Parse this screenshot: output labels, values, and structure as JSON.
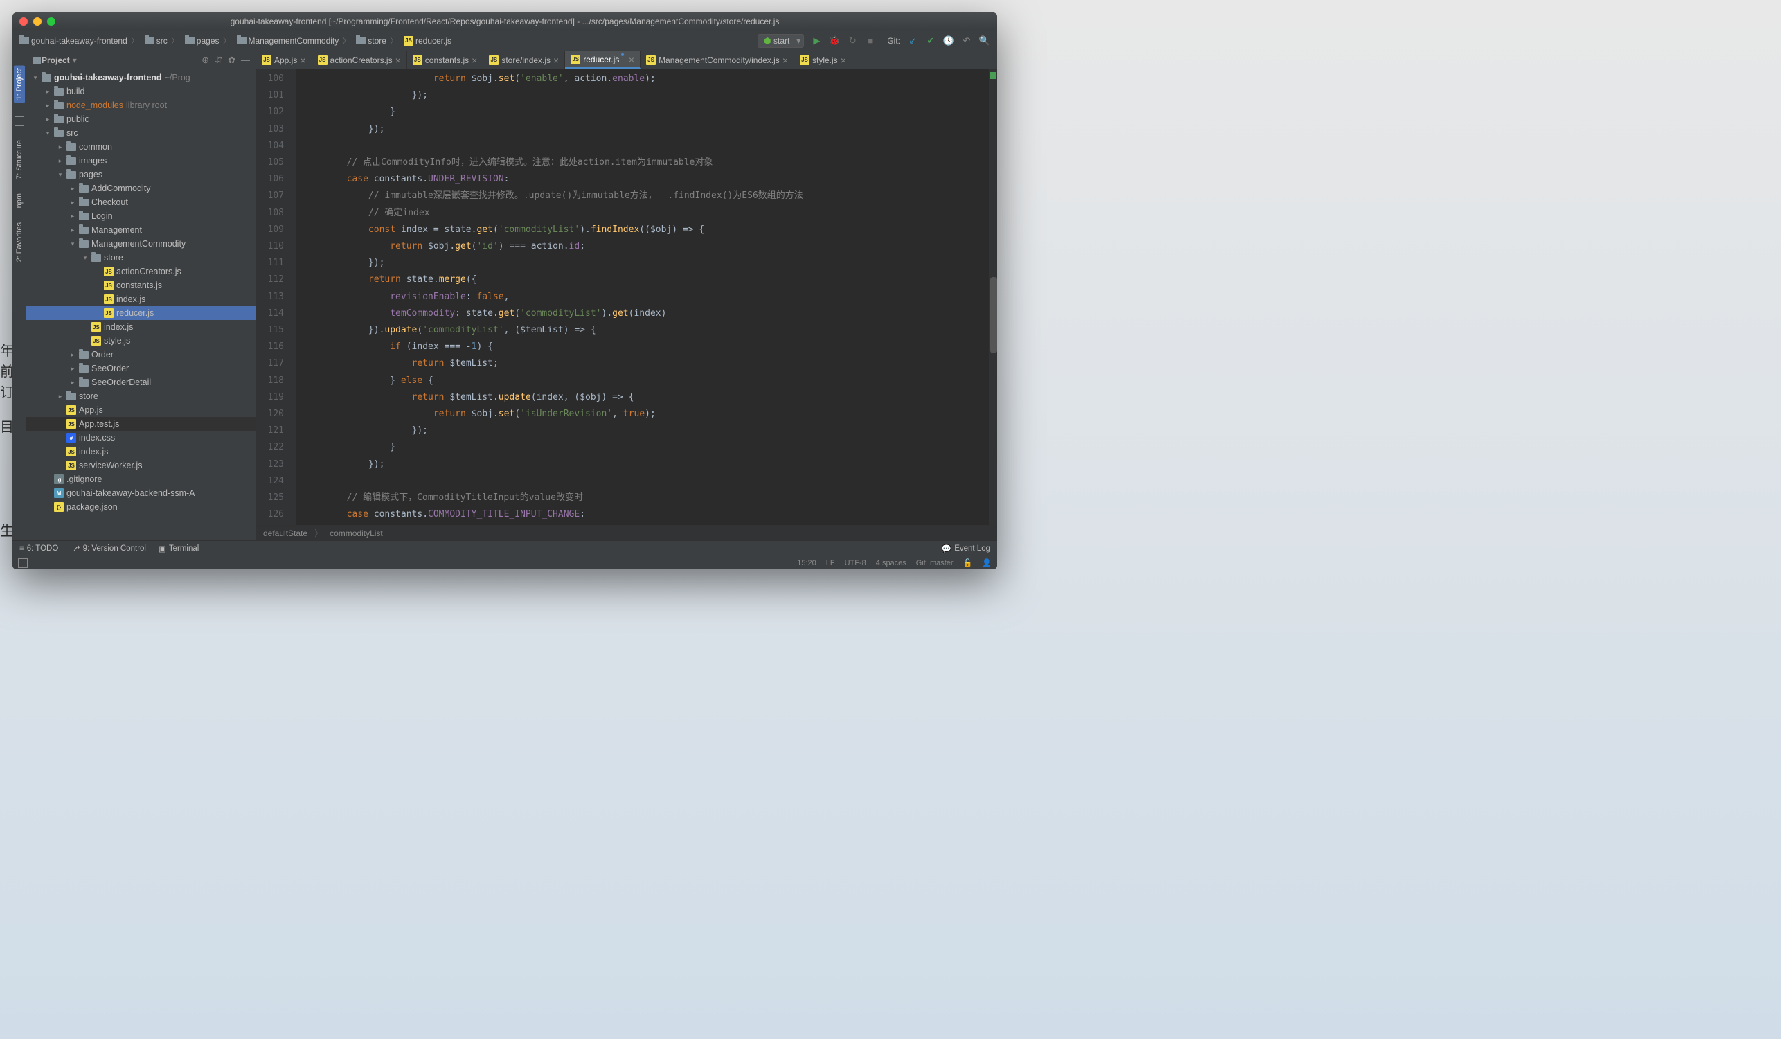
{
  "window": {
    "title": "gouhai-takeaway-frontend [~/Programming/Frontend/React/Repos/gouhai-takeaway-frontend] - .../src/pages/ManagementCommodity/store/reducer.js"
  },
  "nav": {
    "crumbs": [
      "gouhai-takeaway-frontend",
      "src",
      "pages",
      "ManagementCommodity",
      "store",
      "reducer.js"
    ],
    "run_config": "start",
    "git_label": "Git:"
  },
  "project_panel": {
    "title": "Project"
  },
  "tree": {
    "root_name": "gouhai-takeaway-frontend",
    "root_path": "~/Prog",
    "items": [
      {
        "depth": 1,
        "arrow": "▸",
        "icon": "folder",
        "label": "build"
      },
      {
        "depth": 1,
        "arrow": "▸",
        "icon": "folder",
        "label": "node_modules",
        "suffix": "library root",
        "class": "highlighted"
      },
      {
        "depth": 1,
        "arrow": "▸",
        "icon": "folder",
        "label": "public"
      },
      {
        "depth": 1,
        "arrow": "▾",
        "icon": "folder",
        "label": "src"
      },
      {
        "depth": 2,
        "arrow": "▸",
        "icon": "folder",
        "label": "common"
      },
      {
        "depth": 2,
        "arrow": "▸",
        "icon": "folder",
        "label": "images"
      },
      {
        "depth": 2,
        "arrow": "▾",
        "icon": "folder",
        "label": "pages"
      },
      {
        "depth": 3,
        "arrow": "▸",
        "icon": "folder",
        "label": "AddCommodity"
      },
      {
        "depth": 3,
        "arrow": "▸",
        "icon": "folder",
        "label": "Checkout"
      },
      {
        "depth": 3,
        "arrow": "▸",
        "icon": "folder",
        "label": "Login"
      },
      {
        "depth": 3,
        "arrow": "▸",
        "icon": "folder",
        "label": "Management"
      },
      {
        "depth": 3,
        "arrow": "▾",
        "icon": "folder",
        "label": "ManagementCommodity"
      },
      {
        "depth": 4,
        "arrow": "▾",
        "icon": "folder",
        "label": "store"
      },
      {
        "depth": 5,
        "arrow": "",
        "icon": "js",
        "label": "actionCreators.js"
      },
      {
        "depth": 5,
        "arrow": "",
        "icon": "js",
        "label": "constants.js"
      },
      {
        "depth": 5,
        "arrow": "",
        "icon": "js",
        "label": "index.js"
      },
      {
        "depth": 5,
        "arrow": "",
        "icon": "js",
        "label": "reducer.js",
        "sel": true
      },
      {
        "depth": 4,
        "arrow": "",
        "icon": "js",
        "label": "index.js"
      },
      {
        "depth": 4,
        "arrow": "",
        "icon": "js",
        "label": "style.js"
      },
      {
        "depth": 3,
        "arrow": "▸",
        "icon": "folder",
        "label": "Order"
      },
      {
        "depth": 3,
        "arrow": "▸",
        "icon": "folder",
        "label": "SeeOrder"
      },
      {
        "depth": 3,
        "arrow": "▸",
        "icon": "folder",
        "label": "SeeOrderDetail"
      },
      {
        "depth": 2,
        "arrow": "▸",
        "icon": "folder",
        "label": "store"
      },
      {
        "depth": 2,
        "arrow": "",
        "icon": "js",
        "label": "App.js"
      },
      {
        "depth": 2,
        "arrow": "",
        "icon": "js",
        "label": "App.test.js",
        "hl": true
      },
      {
        "depth": 2,
        "arrow": "",
        "icon": "css",
        "label": "index.css"
      },
      {
        "depth": 2,
        "arrow": "",
        "icon": "js",
        "label": "index.js"
      },
      {
        "depth": 2,
        "arrow": "",
        "icon": "js",
        "label": "serviceWorker.js"
      },
      {
        "depth": 1,
        "arrow": "",
        "icon": "gi",
        "label": ".gitignore"
      },
      {
        "depth": 1,
        "arrow": "",
        "icon": "md",
        "label": "gouhai-takeaway-backend-ssm-A"
      },
      {
        "depth": 1,
        "arrow": "",
        "icon": "json",
        "label": "package.json"
      }
    ]
  },
  "tabs": [
    {
      "label": "App.js"
    },
    {
      "label": "actionCreators.js"
    },
    {
      "label": "constants.js"
    },
    {
      "label": "store/index.js"
    },
    {
      "label": "reducer.js",
      "active": true,
      "dot": true
    },
    {
      "label": "ManagementCommodity/index.js"
    },
    {
      "label": "style.js"
    }
  ],
  "line_start": 100,
  "line_end": 126,
  "code_lines": [
    "                        <kw>return</kw> $obj.<fn>set</fn>(<str>'enable'</str>, action.<prop>enable</prop>);",
    "                    });",
    "                }",
    "            });",
    "",
    "        <com>// 点击CommodityInfo时，进入编辑模式。注意：此处action.item为immutable对象</com>",
    "        <kw>case</kw> constants.<prop>UNDER_REVISION</prop>:",
    "            <com>// immutable深层嵌套查找并修改。.update()为immutable方法，  .findIndex()为ES6数组的方法</com>",
    "            <com>// 确定index</com>",
    "            <kw>const</kw> index = state.<fn>get</fn>(<str>'commodityList'</str>).<fn>findIndex</fn>(($obj) =&gt; {",
    "                <kw>return</kw> $obj.<fn>get</fn>(<str>'id'</str>) === action.<prop>id</prop>;",
    "            });",
    "            <kw>return</kw> state.<fn>merge</fn>({",
    "                <prop>revisionEnable</prop>: <kw>false</kw>,",
    "                <prop>temCommodity</prop>: state.<fn>get</fn>(<str>'commodityList'</str>).<fn>get</fn>(index)",
    "            }).<fn>update</fn>(<str>'commodityList'</str>, ($temList) =&gt; {",
    "                <kw>if</kw> (index === -<num>1</num>) {",
    "                    <kw>return</kw> $temList;",
    "                } <kw>else</kw> {",
    "                    <kw>return</kw> $temList.<fn>update</fn>(index, ($obj) =&gt; {",
    "                        <kw>return</kw> $obj.<fn>set</fn>(<str>'isUnderRevision'</str>, <kw>true</kw>);",
    "                    });",
    "                }",
    "            });",
    "",
    "        <com>// 编辑模式下，CommodityTitleInput的value改变时</com>",
    "        <kw>case</kw> constants.<prop>COMMODITY_TITLE_INPUT_CHANGE</prop>:"
  ],
  "breadcrumb": {
    "a": "defaultState",
    "b": "commodityList"
  },
  "toolwin": {
    "todo": "6: TODO",
    "vcs": "9: Version Control",
    "term": "Terminal",
    "eventlog": "Event Log"
  },
  "status": {
    "pos": "15:20",
    "le": "LF",
    "enc": "UTF-8",
    "indent": "4 spaces",
    "git": "Git: master"
  },
  "left_labels": {
    "project": "1: Project",
    "structure": "7: Structure",
    "favorites": "2: Favorites",
    "npm": "npm"
  }
}
